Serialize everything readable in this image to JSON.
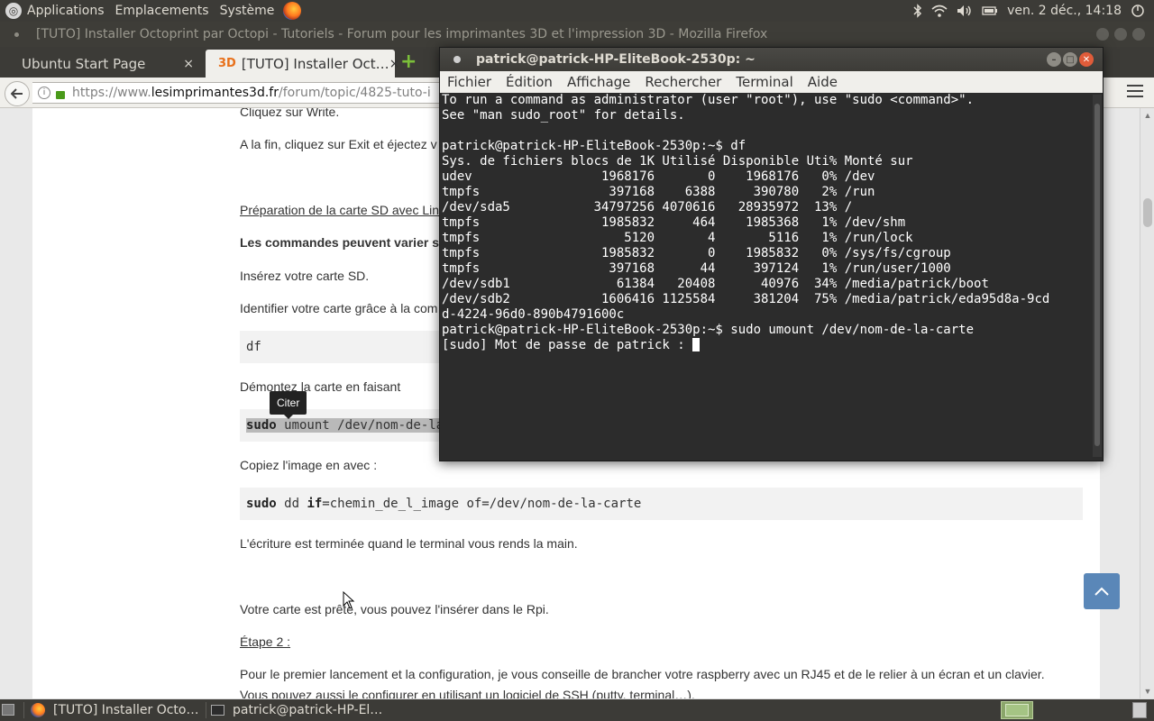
{
  "top_panel": {
    "menus": [
      "Applications",
      "Emplacements",
      "Système"
    ],
    "clock": "ven. 2 déc., 14:18"
  },
  "firefox": {
    "window_title": "[TUTO] Installer Octoprint par Octopi - Tutoriels - Forum pour les imprimantes 3D et l'impression 3D - Mozilla Firefox",
    "tabs": [
      {
        "label": "Ubuntu Start Page",
        "close": "×"
      },
      {
        "favicon": "3D",
        "label": "[TUTO] Installer Oct…",
        "close": "×"
      }
    ],
    "new_tab": "+",
    "url": {
      "prefix": "https://www.",
      "host": "lesimprimantes3d.fr",
      "path": "/forum/topic/4825-tuto-i"
    }
  },
  "page": {
    "lines": {
      "l1": "Cliquez sur Write.",
      "l2": "A la fin, cliquez sur Exit et éjectez v",
      "l3": "Préparation de la carte SD avec Lin",
      "l4": "Les commandes peuvent varier s",
      "l5": "Insérez votre carte SD.",
      "l6": "Identifier votre carte grâce à la com",
      "l7": "Démontez la carte en faisant",
      "l8": "Copiez l'image en avec :",
      "l9": "L'écriture est terminée quand le terminal vous rends la main.",
      "l10": "Votre carte est prête, vous pouvez l'insérer dans le Rpi.",
      "l11": "Étape 2 :",
      "l12": "Pour le premier lancement et la configuration, je vous conseille de brancher votre raspberry avec un RJ45 et de le relier à un écran et un clavier.",
      "l13": "Vous pouvez aussi le configurer en utilisant un logiciel de SSH (putty, terminal…)."
    },
    "code_df": "df",
    "code_umount": {
      "kw": "sudo",
      "rest": " umount /dev/nom-de-la-"
    },
    "code_dd": {
      "kw1": "sudo",
      "t1": " dd ",
      "kw2": "if",
      "t2": "=chemin_de_l_image of=/dev/nom-de-la-carte"
    },
    "tooltip": "Citer"
  },
  "terminal": {
    "title": "patrick@patrick-HP-EliteBook-2530p: ~",
    "menu": [
      "Fichier",
      "Édition",
      "Affichage",
      "Rechercher",
      "Terminal",
      "Aide"
    ],
    "lines": [
      "To run a command as administrator (user \"root\"), use \"sudo <command>\".",
      "See \"man sudo_root\" for details.",
      "",
      "patrick@patrick-HP-EliteBook-2530p:~$ df",
      "Sys. de fichiers blocs de 1K Utilisé Disponible Uti% Monté sur",
      "udev                 1968176       0    1968176   0% /dev",
      "tmpfs                 397168    6388     390780   2% /run",
      "/dev/sda5           34797256 4070616   28935972  13% /",
      "tmpfs                1985832     464    1985368   1% /dev/shm",
      "tmpfs                   5120       4       5116   1% /run/lock",
      "tmpfs                1985832       0    1985832   0% /sys/fs/cgroup",
      "tmpfs                 397168      44     397124   1% /run/user/1000",
      "/dev/sdb1              61384   20408      40976  34% /media/patrick/boot",
      "/dev/sdb2            1606416 1125584     381204  75% /media/patrick/eda95d8a-9cd",
      "d-4224-96d0-890b4791600c",
      "patrick@patrick-HP-EliteBook-2530p:~$ sudo umount /dev/nom-de-la-carte"
    ],
    "prompt_line": "[sudo] Mot de passe de patrick : "
  },
  "taskbar": {
    "items": [
      "[TUTO] Installer Octo…",
      "patrick@patrick-HP-El…"
    ]
  }
}
